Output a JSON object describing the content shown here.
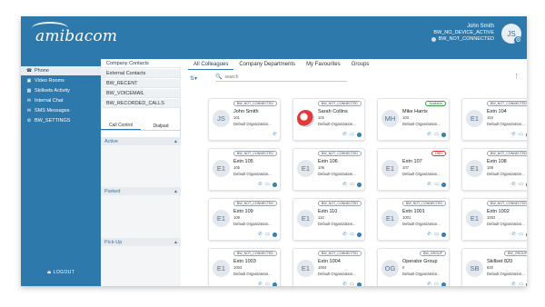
{
  "app": {
    "logo_text": "amibacom",
    "user": {
      "name": "John Smith",
      "status1": "BW_NO_DEVICE_ACTIVE",
      "status2": "BW_NOT_CONNECTED",
      "initials": "JS"
    }
  },
  "sidebar": {
    "items": [
      {
        "label": "Phone",
        "icon": "phone-icon",
        "active": true
      },
      {
        "label": "Video Rooms",
        "icon": "video-icon"
      },
      {
        "label": "Skillsets Activity",
        "icon": "skillsets-icon"
      },
      {
        "label": "Internal Chat",
        "icon": "chat-icon"
      },
      {
        "label": "SMS Messages",
        "icon": "sms-icon"
      },
      {
        "label": "BW_SETTINGS",
        "icon": "gear-icon"
      }
    ],
    "logout": "LOGOUT"
  },
  "contacts_col": {
    "tabs": [
      "Company Contacts",
      "External Contacts",
      "BW_RECENT",
      "BW_VOICEMAIL",
      "BW_RECORDED_CALLS"
    ],
    "call_tabs": [
      "Call Control",
      "Dialpad"
    ],
    "sections": [
      "Active",
      "Parked",
      "Pick-Up"
    ]
  },
  "main": {
    "tabs": [
      "All Colleagues",
      "Company Departments",
      "My Favourites",
      "Groups"
    ],
    "search_placeholder": "search"
  },
  "cards": [
    {
      "initials": "JS",
      "name": "John Smith",
      "ext": "101",
      "org": "Default Organization",
      "badge": "BW_NOT_CONNECTED",
      "badge_type": "normal",
      "actions": [
        "phone"
      ]
    },
    {
      "initials": "",
      "name": "Sarah Collins",
      "ext": "102",
      "org": "Default Organization",
      "badge": "BW_NOT_CONNECTED",
      "badge_type": "normal",
      "photo": true,
      "actions": [
        "phone",
        "video",
        "chat"
      ]
    },
    {
      "initials": "MH",
      "name": "Mike Harris",
      "ext": "103",
      "org": "Default Organization",
      "badge": "Available",
      "badge_type": "available",
      "actions": [
        "phone",
        "video",
        "chat"
      ]
    },
    {
      "initials": "E1",
      "name": "Extn 104",
      "ext": "104",
      "org": "Default Organization",
      "badge": "BW_NOT_CONNECTED",
      "badge_type": "normal",
      "actions": [
        "phone",
        "video",
        "chat"
      ]
    },
    {
      "initials": "E1",
      "name": "Extn 105",
      "ext": "105",
      "org": "Default Organization",
      "badge": "BW_NOT_CONNECTED",
      "badge_type": "normal",
      "actions": [
        "phone",
        "video",
        "chat"
      ]
    },
    {
      "initials": "E1",
      "name": "Extn 106",
      "ext": "106",
      "org": "Default Organization",
      "badge": "BW_NOT_CONNECTED",
      "badge_type": "normal",
      "actions": [
        "phone",
        "video",
        "chat"
      ]
    },
    {
      "initials": "E1",
      "name": "Extn 107",
      "ext": "107",
      "org": "Default Organization",
      "badge": "DND",
      "badge_type": "dnd",
      "actions": [
        "phone",
        "video",
        "chat"
      ]
    },
    {
      "initials": "E1",
      "name": "Extn 108",
      "ext": "108",
      "org": "Default Organization",
      "badge": "BW_NOT_CONNECTED",
      "badge_type": "normal",
      "actions": [
        "phone",
        "video",
        "chat"
      ]
    },
    {
      "initials": "E1",
      "name": "Extn 109",
      "ext": "109",
      "org": "Default Organization",
      "badge": "BW_NOT_CONNECTED",
      "badge_type": "normal",
      "actions": [
        "phone",
        "video",
        "chat"
      ]
    },
    {
      "initials": "E1",
      "name": "Extn 110",
      "ext": "110",
      "org": "Default Organization",
      "badge": "BW_NOT_CONNECTED",
      "badge_type": "normal",
      "actions": [
        "phone",
        "video",
        "chat"
      ]
    },
    {
      "initials": "E1",
      "name": "Extn 1001",
      "ext": "1001",
      "org": "Default Organization",
      "badge": "BW_NOT_CONNECTED",
      "badge_type": "normal",
      "actions": [
        "phone",
        "video",
        "chat"
      ]
    },
    {
      "initials": "E1",
      "name": "Extn 1002",
      "ext": "1002",
      "org": "Default Organization",
      "badge": "BW_NOT_CONNECTED",
      "badge_type": "normal",
      "actions": [
        "phone",
        "video",
        "chat"
      ]
    },
    {
      "initials": "E1",
      "name": "Extn 1003",
      "ext": "1003",
      "org": "Default Organization",
      "badge": "BW_NOT_CONNECTED",
      "badge_type": "normal",
      "actions": [
        "phone",
        "video",
        "chat"
      ]
    },
    {
      "initials": "E1",
      "name": "Extn 1004",
      "ext": "1004",
      "org": "Default Organization",
      "badge": "BW_NOT_CONNECTED",
      "badge_type": "normal",
      "actions": [
        "phone",
        "video",
        "chat"
      ]
    },
    {
      "initials": "OG",
      "name": "Operator Group",
      "ext": "0",
      "org": "Default Organization",
      "badge": "BW_GROUP",
      "badge_type": "normal",
      "actions": [
        "phone",
        "video",
        "chat"
      ]
    },
    {
      "initials": "SB",
      "name": "Skillset 820",
      "ext": "820",
      "org": "Default Organization",
      "badge": "BW_GROUP",
      "badge_type": "normal",
      "actions": [
        "phone",
        "video",
        "chat"
      ]
    }
  ],
  "colors": {
    "brand": "#2e79ac",
    "available": "#3a9a44",
    "dnd": "#dd3333"
  }
}
